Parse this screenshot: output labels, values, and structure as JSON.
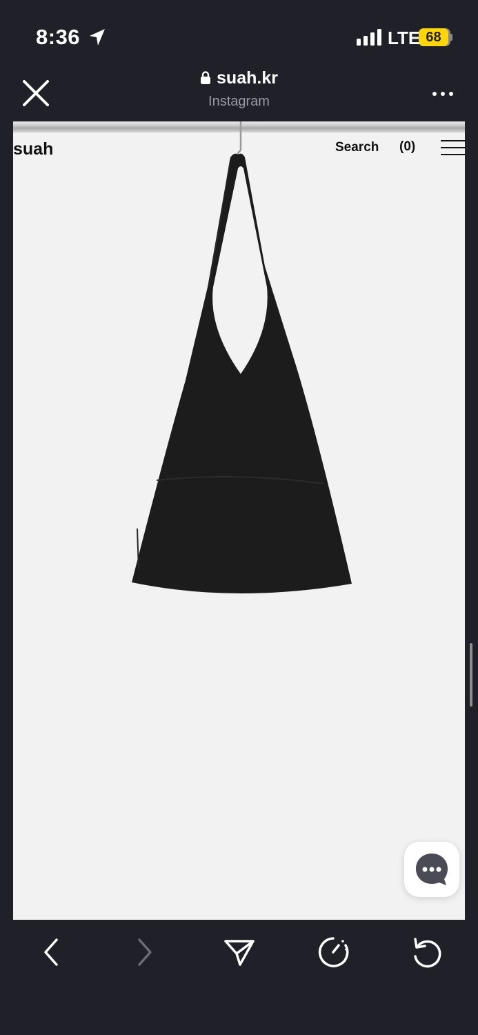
{
  "status_bar": {
    "time": "8:36",
    "network": "LTE",
    "battery": "68"
  },
  "browser": {
    "url": "suah.kr",
    "subtitle": "Instagram"
  },
  "site": {
    "logo": "suah",
    "search_label": "Search",
    "cart_label": "(0)"
  },
  "product": {
    "image_alt": "black suede hobo shoulder bag hanging on a rail"
  },
  "icons": {
    "close": "close-icon",
    "lock": "lock-icon",
    "more": "more-icon",
    "menu": "hamburger-menu-icon",
    "chat": "chat-bubble-icon",
    "back": "chevron-left-icon",
    "forward": "chevron-right-icon",
    "share": "send-icon",
    "timer": "timer-icon",
    "reload": "reload-icon"
  },
  "colors": {
    "chrome_bg": "#1f2028",
    "battery": "#ffd60a",
    "page_bg": "#f2f2f2",
    "bag": "#1c1c1c"
  }
}
